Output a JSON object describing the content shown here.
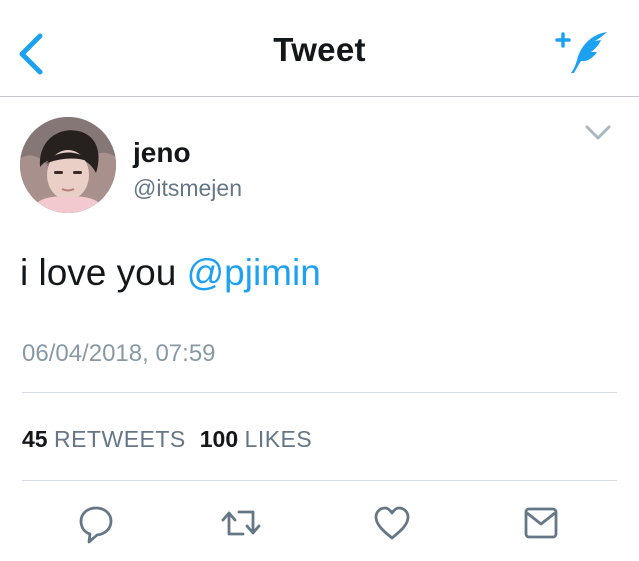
{
  "nav": {
    "title": "Tweet",
    "back_icon": "chevron-left-icon",
    "compose_icon": "compose-tweet-icon",
    "accent_color": "#1da1f2"
  },
  "tweet": {
    "user": {
      "name": "jeno",
      "handle": "@itsmejen"
    },
    "text_before_mention": "i love you ",
    "mention": "@pjimin",
    "timestamp": "06/04/2018, 07:59",
    "retweets_count": "45",
    "retweets_label": "RETWEETS",
    "likes_count": "100",
    "likes_label": "LIKES"
  },
  "actions": [
    {
      "name": "reply",
      "icon": "reply-icon"
    },
    {
      "name": "retweet",
      "icon": "retweet-icon"
    },
    {
      "name": "like",
      "icon": "heart-icon"
    },
    {
      "name": "message",
      "icon": "envelope-icon"
    }
  ]
}
